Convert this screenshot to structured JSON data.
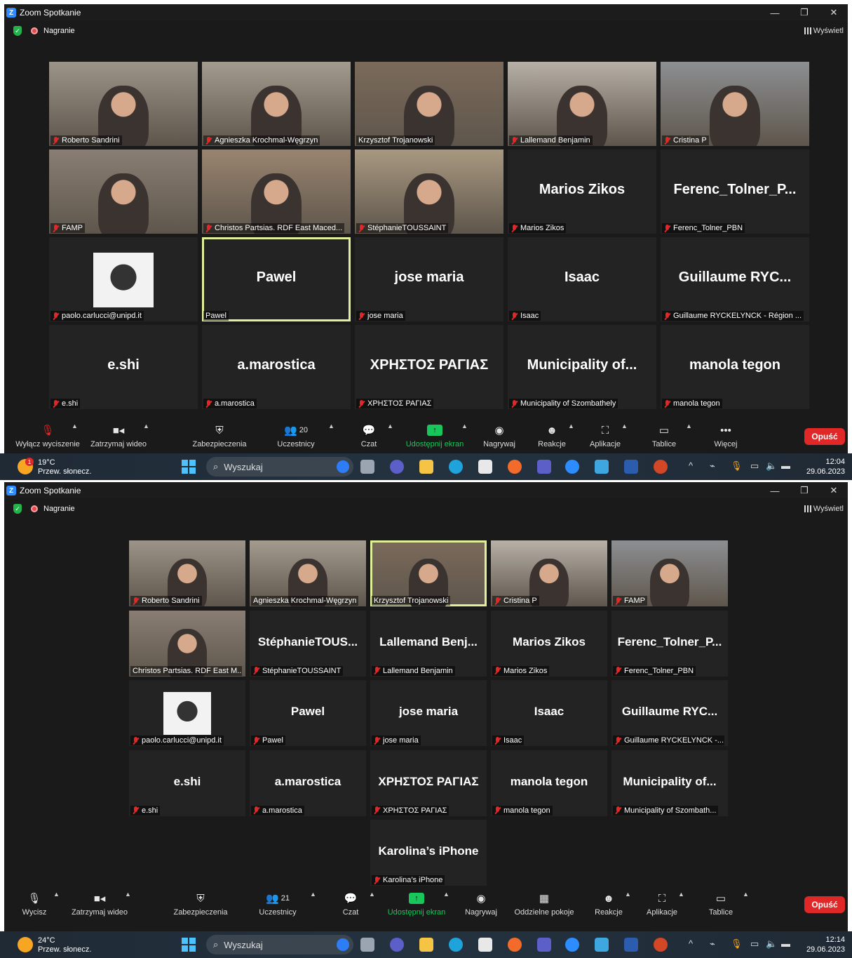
{
  "top": {
    "title": "Zoom Spotkanie",
    "recording": "Nagranie",
    "view": "Wyświetl",
    "tiles": [
      {
        "big": "",
        "label": "Roberto Sandrini",
        "muted": true,
        "video": true
      },
      {
        "big": "",
        "label": "Agnieszka Krochmal-Węgrzyn",
        "muted": true,
        "video": true
      },
      {
        "big": "",
        "label": "Krzysztof Trojanowski",
        "muted": false,
        "video": true
      },
      {
        "big": "",
        "label": "Lallemand Benjamin",
        "muted": true,
        "video": true
      },
      {
        "big": "",
        "label": "Cristina P",
        "muted": true,
        "video": true
      },
      {
        "big": "",
        "label": "FAMP",
        "muted": true,
        "video": true
      },
      {
        "big": "",
        "label": "Christos Partsias. RDF East Maced...",
        "muted": true,
        "video": true
      },
      {
        "big": "",
        "label": "StéphanieTOUSSAINT",
        "muted": true,
        "video": true
      },
      {
        "big": "Marios Zikos",
        "label": "Marios Zikos",
        "muted": true,
        "video": false
      },
      {
        "big": "Ferenc_Tolner_P...",
        "label": "Ferenc_Tolner_PBN",
        "muted": true,
        "video": false
      },
      {
        "big": "",
        "label": "paolo.carlucci@unipd.it",
        "muted": true,
        "video": false,
        "avatar": true
      },
      {
        "big": "Pawel",
        "label": "Pawel",
        "muted": false,
        "video": false,
        "active": true
      },
      {
        "big": "jose maria",
        "label": "jose maria",
        "muted": true,
        "video": false
      },
      {
        "big": "Isaac",
        "label": "Isaac",
        "muted": true,
        "video": false
      },
      {
        "big": "Guillaume RYC...",
        "label": "Guillaume RYCKELYNCK - Région ...",
        "muted": true,
        "video": false
      },
      {
        "big": "e.shi",
        "label": "e.shi",
        "muted": true,
        "video": false
      },
      {
        "big": "a.marostica",
        "label": "a.marostica",
        "muted": true,
        "video": false
      },
      {
        "big": "ΧΡΗΣΤΟΣ ΡΑΓΙΑΣ",
        "label": "ΧΡΗΣΤΟΣ ΡΑΓΙΑΣ",
        "muted": true,
        "video": false
      },
      {
        "big": "Municipality of...",
        "label": "Municipality of Szombathely",
        "muted": true,
        "video": false
      },
      {
        "big": "manola tegon",
        "label": "manola tegon",
        "muted": true,
        "video": false
      }
    ],
    "toolbar": {
      "mute": "Wyłącz wyciszenie",
      "video": "Zatrzymaj wideo",
      "security": "Zabezpieczenia",
      "participants": "Uczestnicy",
      "participants_count": "20",
      "chat": "Czat",
      "share": "Udostępnij ekran",
      "record": "Nagrywaj",
      "reactions": "Reakcje",
      "apps": "Aplikacje",
      "whiteboards": "Tablice",
      "more": "Więcej",
      "leave": "Opuść"
    },
    "taskbar": {
      "temp": "19°C",
      "weather": "Przew. słonecz.",
      "search": "Wyszukaj",
      "time": "12:04",
      "date": "29.06.2023",
      "badge": "1"
    }
  },
  "bottom": {
    "title": "Zoom Spotkanie",
    "recording": "Nagranie",
    "view": "Wyświetl",
    "tiles": [
      {
        "big": "",
        "label": "Roberto Sandrini",
        "muted": true,
        "video": true
      },
      {
        "big": "",
        "label": "Agnieszka Krochmal-Węgrzyn",
        "muted": false,
        "video": true
      },
      {
        "big": "",
        "label": "Krzysztof Trojanowski",
        "muted": false,
        "video": true,
        "active": true
      },
      {
        "big": "",
        "label": "Cristina P",
        "muted": true,
        "video": true
      },
      {
        "big": "",
        "label": "FAMP",
        "muted": true,
        "video": true
      },
      {
        "big": "",
        "label": "Christos Partsias. RDF East M...",
        "muted": false,
        "video": true
      },
      {
        "big": "StéphanieTOUS...",
        "label": "StéphanieTOUSSAINT",
        "muted": true,
        "video": false
      },
      {
        "big": "Lallemand Benj...",
        "label": "Lallemand Benjamin",
        "muted": true,
        "video": false
      },
      {
        "big": "Marios Zikos",
        "label": "Marios Zikos",
        "muted": true,
        "video": false
      },
      {
        "big": "Ferenc_Tolner_P...",
        "label": "Ferenc_Tolner_PBN",
        "muted": true,
        "video": false
      },
      {
        "big": "",
        "label": "paolo.carlucci@unipd.it",
        "muted": true,
        "video": false,
        "avatar": true
      },
      {
        "big": "Pawel",
        "label": "Pawel",
        "muted": true,
        "video": false
      },
      {
        "big": "jose maria",
        "label": "jose maria",
        "muted": true,
        "video": false
      },
      {
        "big": "Isaac",
        "label": "Isaac",
        "muted": true,
        "video": false
      },
      {
        "big": "Guillaume RYC...",
        "label": "Guillaume RYCKELYNCK -...",
        "muted": true,
        "video": false
      },
      {
        "big": "e.shi",
        "label": "e.shi",
        "muted": true,
        "video": false
      },
      {
        "big": "a.marostica",
        "label": "a.marostica",
        "muted": true,
        "video": false
      },
      {
        "big": "ΧΡΗΣΤΟΣ ΡΑΓΙΑΣ",
        "label": "ΧΡΗΣΤΟΣ ΡΑΓΙΑΣ",
        "muted": true,
        "video": false
      },
      {
        "big": "manola tegon",
        "label": "manola tegon",
        "muted": true,
        "video": false
      },
      {
        "big": "Municipality of...",
        "label": "Municipality of Szombath...",
        "muted": true,
        "video": false
      },
      {
        "big": "Karolina’s iPhone",
        "label": "Karolina’s iPhone",
        "muted": true,
        "video": false
      }
    ],
    "toolbar": {
      "mute": "Wycisz",
      "video": "Zatrzymaj wideo",
      "security": "Zabezpieczenia",
      "participants": "Uczestnicy",
      "participants_count": "21",
      "chat": "Czat",
      "share": "Udostępnij ekran",
      "record": "Nagrywaj",
      "breakout": "Oddzielne pokoje",
      "reactions": "Reakcje",
      "apps": "Aplikacje",
      "whiteboards": "Tablice",
      "leave": "Opuść"
    },
    "taskbar": {
      "temp": "24°C",
      "weather": "Przew. słonecz.",
      "search": "Wyszukaj",
      "time": "12:14",
      "date": "29.06.2023"
    }
  }
}
